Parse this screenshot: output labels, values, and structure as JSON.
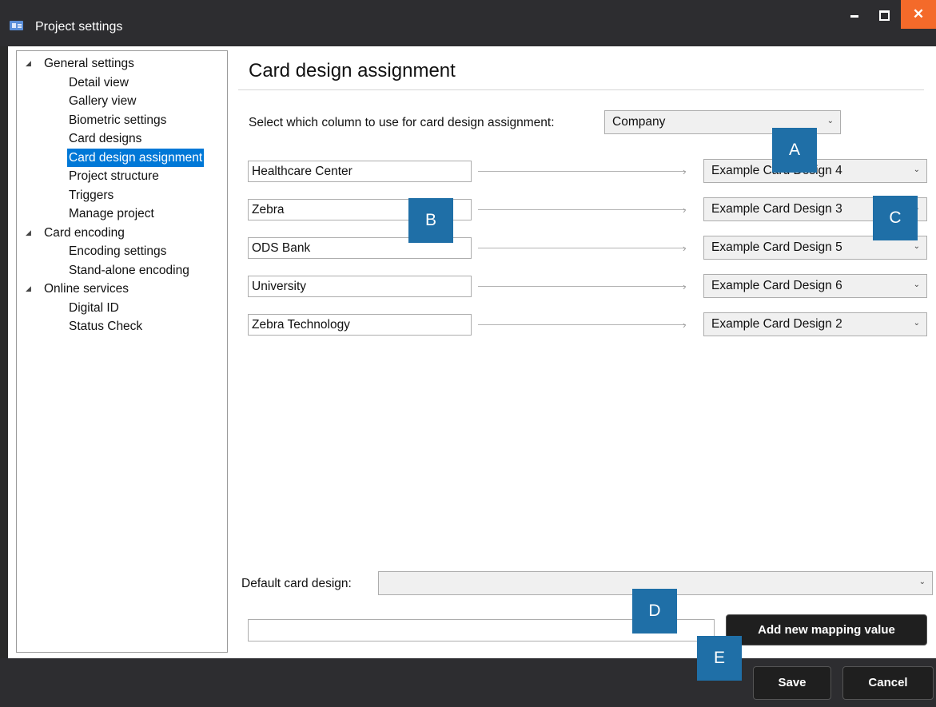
{
  "window": {
    "title": "Project settings",
    "icon": "id-card-icon",
    "controls": {
      "minimize_icon": "minimize-icon",
      "maximize_icon": "maximize-icon",
      "close_glyph": "✕"
    }
  },
  "nav": {
    "tree": [
      {
        "label": "General settings",
        "level": 0,
        "expanded": true
      },
      {
        "label": "Detail view",
        "level": 1
      },
      {
        "label": "Gallery view",
        "level": 1
      },
      {
        "label": "Biometric settings",
        "level": 1
      },
      {
        "label": "Card designs",
        "level": 1
      },
      {
        "label": "Card design assignment",
        "level": 1,
        "selected": true
      },
      {
        "label": "Project structure",
        "level": 1
      },
      {
        "label": "Triggers",
        "level": 1
      },
      {
        "label": "Manage project",
        "level": 1
      },
      {
        "label": "Card encoding",
        "level": 0,
        "expanded": true
      },
      {
        "label": "Encoding settings",
        "level": 1
      },
      {
        "label": "Stand-alone encoding",
        "level": 1
      },
      {
        "label": "Online services",
        "level": 0,
        "expanded": true
      },
      {
        "label": "Digital ID",
        "level": 1
      },
      {
        "label": "Status Check",
        "level": 1
      }
    ]
  },
  "content": {
    "title": "Card design assignment",
    "column_label": "Select which column to use for card design assignment:",
    "column_value": "Company",
    "mappings": [
      {
        "value": "Healthcare Center",
        "design": "Example Card Design 4"
      },
      {
        "value": "Zebra",
        "design": "Example Card Design 3"
      },
      {
        "value": "ODS Bank",
        "design": "Example Card Design 5"
      },
      {
        "value": "University",
        "design": "Example Card Design 6"
      },
      {
        "value": "Zebra Technology",
        "design": "Example Card Design 2"
      }
    ],
    "default_label": "Default card design:",
    "default_value": "",
    "new_value": "",
    "add_button": "Add new mapping value"
  },
  "footer": {
    "save": "Save",
    "cancel": "Cancel"
  },
  "callouts": [
    "A",
    "B",
    "C",
    "D",
    "E"
  ],
  "colors": {
    "accent": "#0078d7",
    "callout": "#1f6fa7",
    "close": "#f46a2a",
    "chrome": "#2d2d30"
  }
}
